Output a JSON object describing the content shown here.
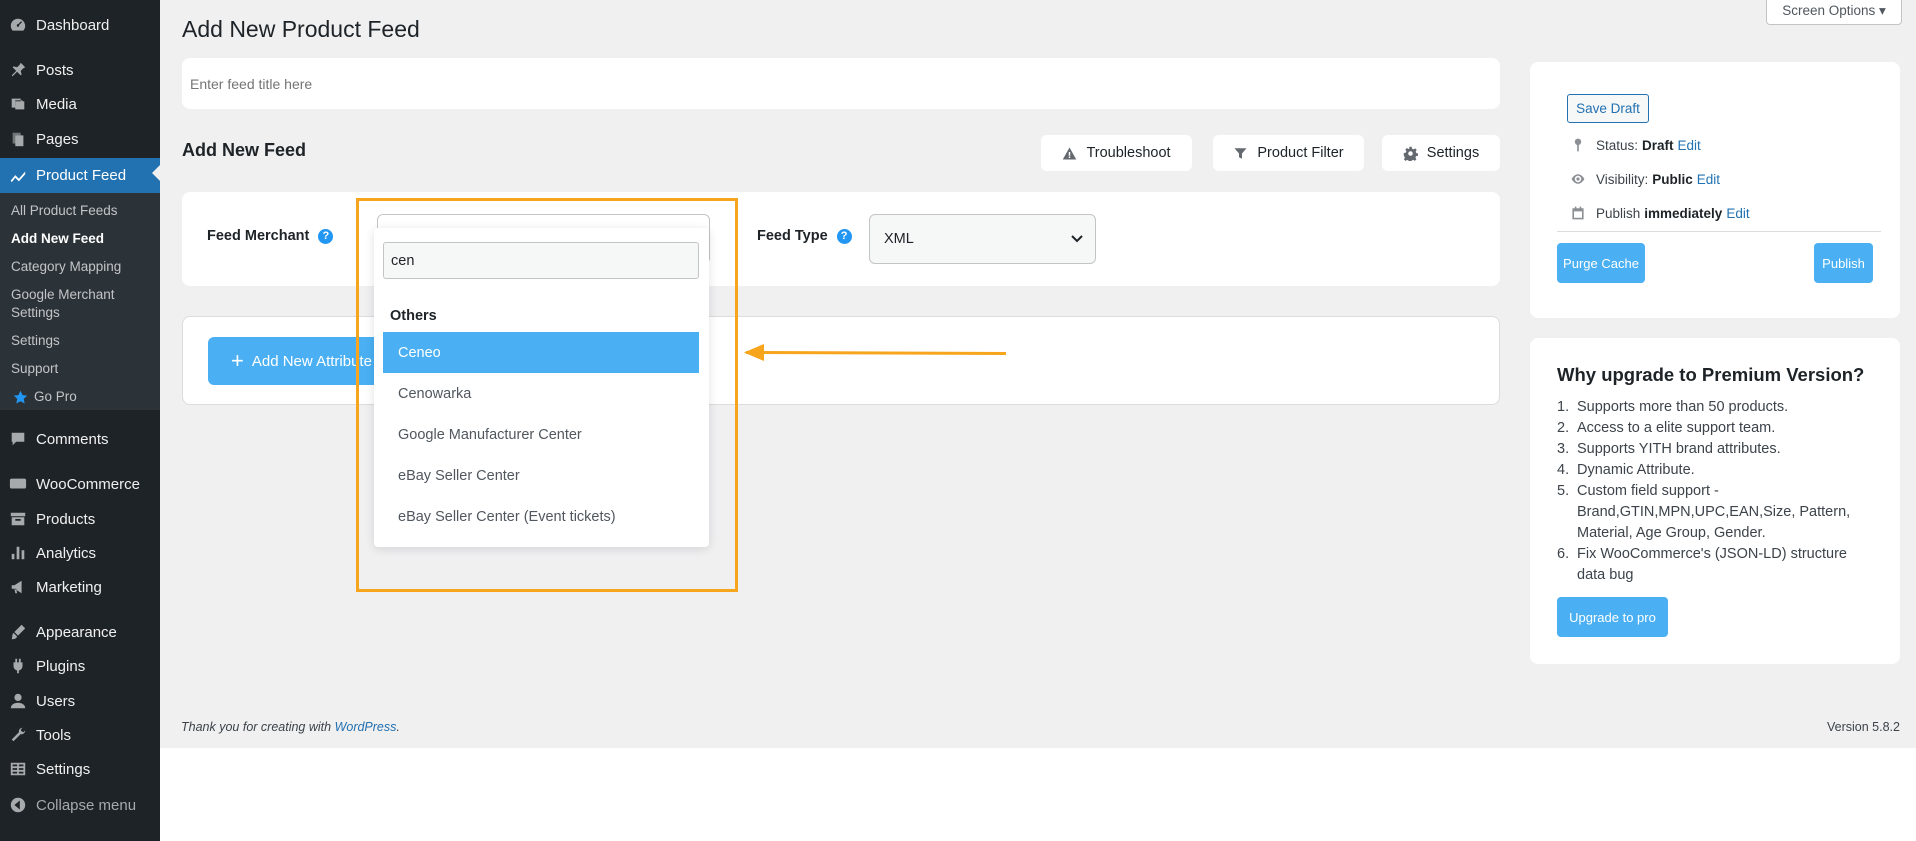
{
  "sidebar": {
    "items": [
      {
        "label": "Dashboard",
        "icon": "dashboard-icon"
      },
      {
        "label": "Posts",
        "icon": "pin-icon"
      },
      {
        "label": "Media",
        "icon": "media-icon"
      },
      {
        "label": "Pages",
        "icon": "pages-icon"
      },
      {
        "label": "Product Feed",
        "icon": "chart-line-icon"
      },
      {
        "label": "Comments",
        "icon": "comment-icon"
      },
      {
        "label": "WooCommerce",
        "icon": "woo-icon"
      },
      {
        "label": "Products",
        "icon": "archive-icon"
      },
      {
        "label": "Analytics",
        "icon": "bar-chart-icon"
      },
      {
        "label": "Marketing",
        "icon": "megaphone-icon"
      },
      {
        "label": "Appearance",
        "icon": "brush-icon"
      },
      {
        "label": "Plugins",
        "icon": "plug-icon"
      },
      {
        "label": "Users",
        "icon": "user-icon"
      },
      {
        "label": "Tools",
        "icon": "wrench-icon"
      },
      {
        "label": "Settings",
        "icon": "settings-icon"
      },
      {
        "label": "Collapse menu",
        "icon": "collapse-icon"
      }
    ],
    "submenu": [
      "All Product Feeds",
      "Add New Feed",
      "Category Mapping",
      "Google Merchant",
      "Settings",
      "Settings",
      "Support",
      "Go Pro"
    ]
  },
  "header": {
    "screen_options": "Screen Options ▾",
    "page_title": "Add New Product Feed",
    "title_placeholder": "Enter feed title here"
  },
  "feed": {
    "section_title": "Add New Feed",
    "troubleshoot": "Troubleshoot",
    "product_filter": "Product Filter",
    "settings": "Settings",
    "merchant_label": "Feed Merchant",
    "type_label": "Feed Type",
    "help": "?",
    "type_value": "XML",
    "add_attribute": "Add New Attribute",
    "plus": "+"
  },
  "dropdown": {
    "search_value": "cen",
    "group": "Others",
    "options": [
      "Ceneo",
      "Cenowarka",
      "Google Manufacturer Center",
      "eBay Seller Center",
      "eBay Seller Center (Event tickets)"
    ],
    "selected": "Ceneo"
  },
  "publish": {
    "save_draft": "Save Draft",
    "status_label": "Status:",
    "status_value": "Draft",
    "visibility_label": "Visibility:",
    "visibility_value": "Public",
    "publish_label": "Publish",
    "publish_value": "immediately",
    "edit": "Edit",
    "purge_cache": "Purge Cache",
    "publish_button": "Publish"
  },
  "upgrade": {
    "title": "Why upgrade to Premium Version?",
    "items": [
      {
        "num": "1.",
        "text": "Supports more than 50 products."
      },
      {
        "num": "2.",
        "text": "Access to a elite support team."
      },
      {
        "num": "3.",
        "text": "Supports YITH brand attributes."
      },
      {
        "num": "4.",
        "text": "Dynamic Attribute."
      },
      {
        "num": "5.",
        "text": "Custom field support - Brand,GTIN,MPN,UPC,EAN,Size, Pattern, Material, Age Group, Gender."
      },
      {
        "num": "6.",
        "text": "Fix WooCommerce's (JSON-LD) structure data bug"
      }
    ],
    "button": "Upgrade to pro"
  },
  "footer": {
    "thanks": "Thank you for creating with",
    "link": "WordPress",
    "period": ".",
    "version": "Version 5.8.2"
  },
  "colors": {
    "sidebar_bg": "#1d2327",
    "active_menu": "#2271b1",
    "accent_blue": "#4ab0f3",
    "highlight_orange": "#f7a51c"
  }
}
